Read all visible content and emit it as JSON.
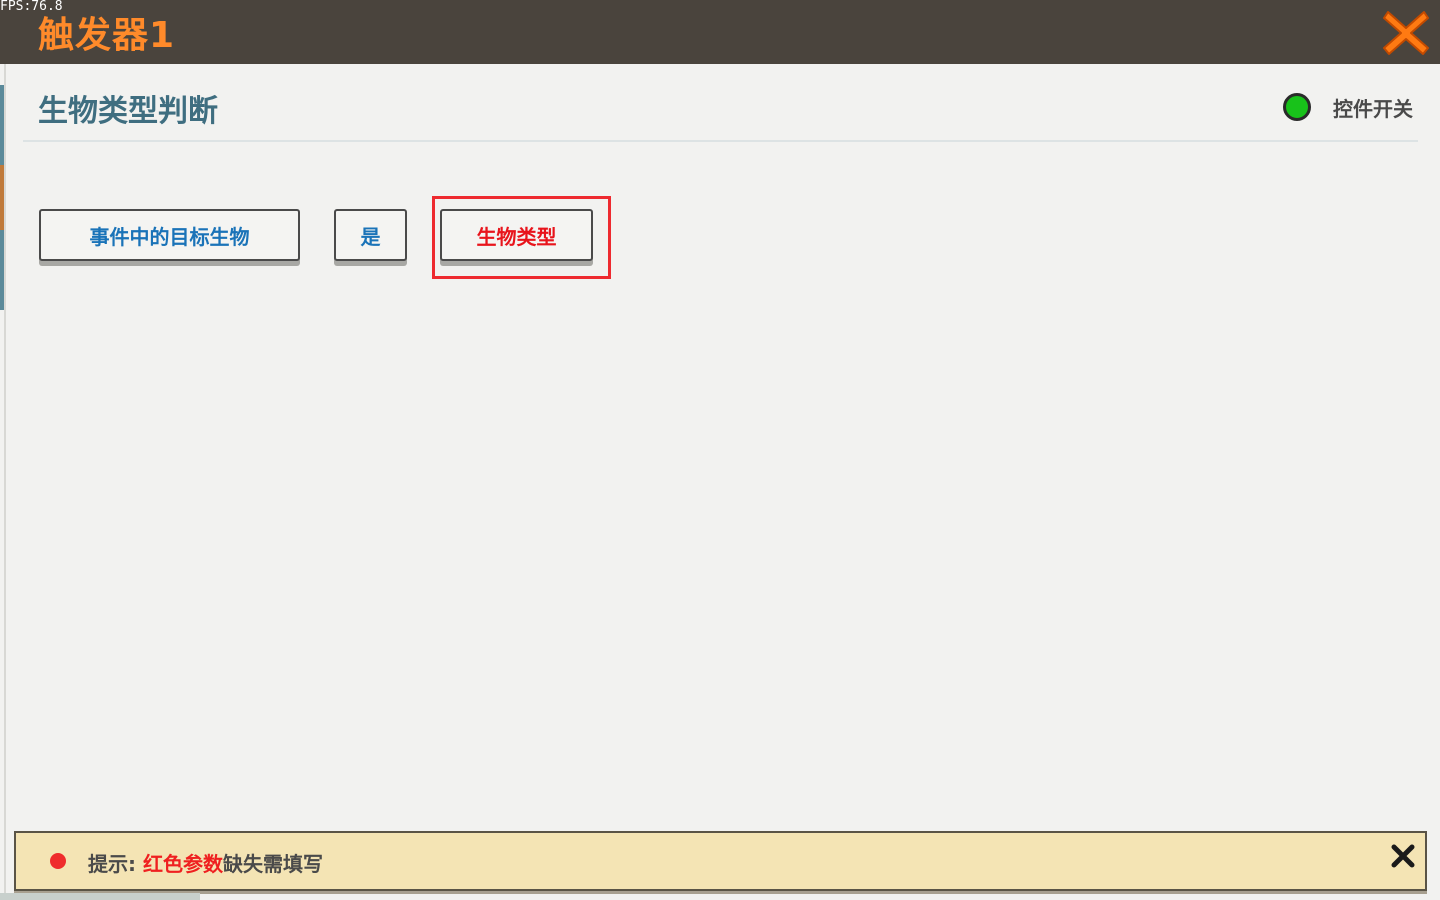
{
  "fps": "FPS:76.8",
  "window": {
    "title": "触发器1",
    "close_icon": "close-x-icon"
  },
  "section": {
    "title": "生物类型判断",
    "switch_label": "控件开关",
    "switch_color": "#18c21a"
  },
  "params": [
    {
      "label": "事件中的目标生物",
      "color": "#1a73b8"
    },
    {
      "label": "是",
      "color": "#1a73b8"
    },
    {
      "label": "生物类型",
      "color": "#e8141c",
      "highlighted": true
    }
  ],
  "hint": {
    "prefix": "提示: ",
    "red_text": "红色参数",
    "suffix": "缺失需填写"
  },
  "colors": {
    "title_orange": "#ff8a2a",
    "titlebar_bg": "#4a443d",
    "highlight_red": "#ee2a2f",
    "hint_bg": "#f4e4b4"
  }
}
